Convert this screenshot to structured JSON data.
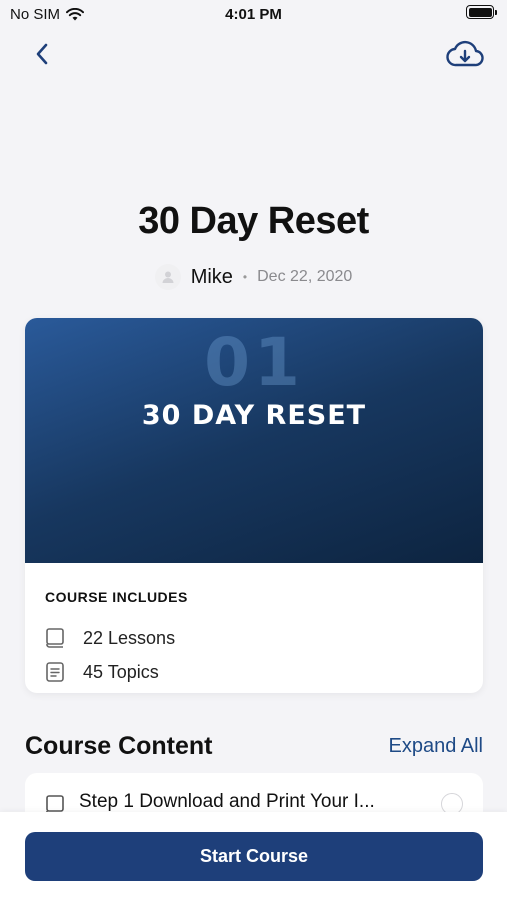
{
  "status_bar": {
    "carrier": "No SIM",
    "time": "4:01 PM"
  },
  "nav": {
    "back_icon": "chevron-left-icon",
    "download_icon": "cloud-download-icon"
  },
  "course": {
    "title": "30 Day Reset",
    "author": "Mike",
    "separator": "•",
    "date": "Dec 22, 2020",
    "banner_number": "01",
    "banner_title": "30 DAY RESET"
  },
  "includes": {
    "heading": "COURSE INCLUDES",
    "items": [
      {
        "icon": "book-icon",
        "text": "22 Lessons"
      },
      {
        "icon": "document-icon",
        "text": "45 Topics"
      }
    ]
  },
  "content": {
    "title": "Course Content",
    "expand_label": "Expand All",
    "lessons": [
      {
        "icon": "book-icon",
        "text": "Step 1 Download and Print Your I..."
      }
    ]
  },
  "footer": {
    "start_label": "Start Course"
  },
  "colors": {
    "accent": "#1e3f7a",
    "link": "#1e4a86",
    "background": "#f4f4f7"
  }
}
